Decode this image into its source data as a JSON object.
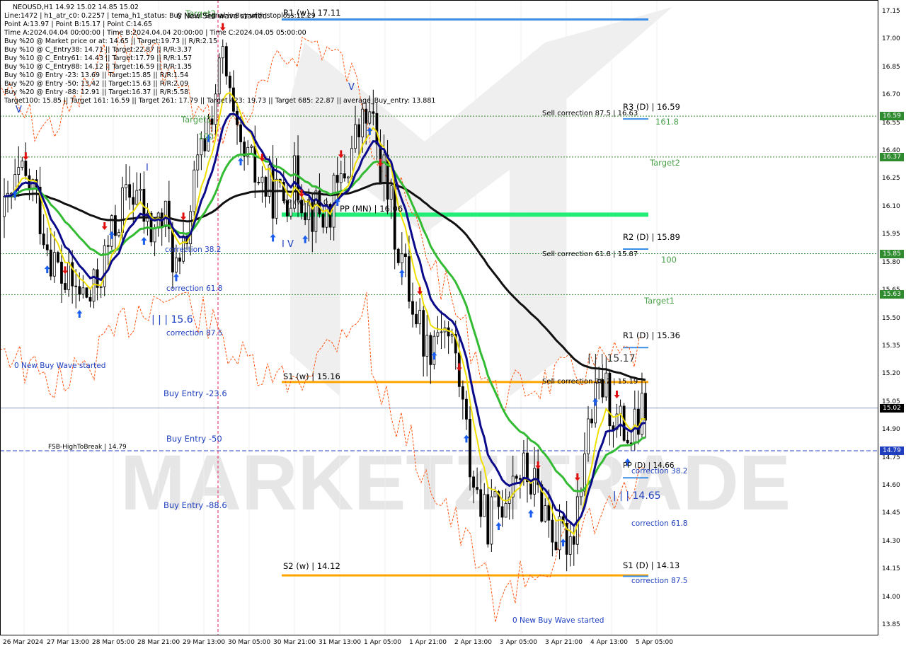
{
  "title": "NEOUSD,H1  14.92 15.02 14.85 15.02",
  "info_lines": [
    "Line:1472 | h1_atr_c0: 0.2257 | tema_h1_status: Buy | Last Signal is:Buy with stoploss:12.29",
    "Point A:13.97 | Point B:15.17 | Point C:14.65",
    "Time A:2024.04.04 00:00:00 | Time B:2024.04.04 20:00:00 | Time C:2024.04.05 05:00:00",
    "Buy %20 @ Market price or at: 14.65 || Target:19.73 || R/R:2.15",
    "Buy %10 @ C_Entry38: 14.71 || Target:22.87 || R/R:3.37",
    "Buy %10 @ C_Entry61: 14.43 || Target:17.79 || R/R:1.57",
    "Buy %10 @ C_Entry88: 14.12 || Target:16.59 || R/R:1.35",
    "Buy %10 @ Entry -23: 13.69 || Target:15.85 || R/R:1.54",
    "Buy %20 @ Entry -50: 13.42 || Target:15.63 || R/R:2.09",
    "Buy %20 @ Entry -88: 12.91 || Target:16.37 || R/R:5.58",
    "Target100: 15.85 || Target 161: 16.59 || Target 261: 17.79 || Target 423: 19.73 || Target 685: 22.87 || average_Buy_entry: 13.881"
  ],
  "watermark": "MARKETZITRADE",
  "y_axis_ticks": [
    "17.15",
    "17.00",
    "16.85",
    "16.70",
    "16.55",
    "16.40",
    "16.25",
    "16.10",
    "15.95",
    "15.80",
    "15.65",
    "15.50",
    "15.35",
    "15.20",
    "15.05",
    "14.90",
    "14.75",
    "14.60",
    "14.45",
    "14.30",
    "14.15",
    "14.00",
    "13.85"
  ],
  "x_axis_ticks": [
    "26 Mar 2024",
    "27 Mar 13:00",
    "28 Mar 05:00",
    "28 Mar 21:00",
    "29 Mar 13:00",
    "30 Mar 05:00",
    "30 Mar 21:00",
    "31 Mar 13:00",
    "1 Apr 05:00",
    "1 Apr 21:00",
    "2 Apr 13:00",
    "3 Apr 05:00",
    "3 Apr 21:00",
    "4 Apr 13:00",
    "5 Apr 05:00"
  ],
  "price_labels": [
    {
      "text": "16.59",
      "color": "#2e8b2e"
    },
    {
      "text": "16.37",
      "color": "#2e8b2e"
    },
    {
      "text": "15.85",
      "color": "#2e8b2e"
    },
    {
      "text": "15.63",
      "color": "#2e8b2e"
    },
    {
      "text": "15.02",
      "color": "#000000"
    },
    {
      "text": "14.79",
      "color": "#1f3fbf"
    }
  ],
  "levels": {
    "r1_w": "R1 (w) | 17.11",
    "s1_w": "S1 (w) | 15.16",
    "s2_w": "S2 (w) | 14.12",
    "pp_mn": "PP (MN) | 16.06",
    "r3_d": "R3 (D) | 16.59",
    "r2_d": "R2 (D) | 15.89",
    "r1_d": "R1 (D) | 15.36",
    "pp_d": "PP (D) | 14.66",
    "s1_d": "S1 (D) | 14.13",
    "fsb": "FSB-HighToBreak | 14.79",
    "sell_875": "Sell correction 87.5 | 16.63",
    "sell_618": "Sell correction 61.8 | 15.87",
    "sell_382": "Sell correction 38.2 | 15.19",
    "target1": "Target1",
    "target2": "Target2",
    "t1618": "161.8",
    "t100_right": "100",
    "t100_left": "100",
    "target1_left": "Target1",
    "target2_left": "Target2",
    "buy_entry_236": "Buy Entry -23.6",
    "buy_entry_50": "Buy Entry -50",
    "buy_entry_886": "Buy Entry -88.6",
    "corr_382_left": "correction 38.2",
    "corr_618_left": "correction 61.8",
    "corr_875_left": "correction 87.5",
    "corr_382_right": "correction 38.2",
    "corr_618_right": "correction 61.8",
    "corr_875_right": "correction 87.5",
    "wave_left": "0 New Buy Wave started",
    "wave_bottom": "0 New Buy Wave started",
    "wave_top": "0 New Sell wave started",
    "lll_156": "| | | 15.6",
    "lll_1517": "| | | 15.17",
    "lll_1465": "| | | 14.65",
    "iv_label": "I V",
    "v_top": "V",
    "v_left": "V",
    "i_left": "I"
  },
  "colors": {
    "ema_blue": "#0a0a8a",
    "ema_yellow": "#f0e000",
    "ema_green": "#33bb33",
    "ma_black": "#111111",
    "weekly_level": "#ffa500",
    "pp_mn": "#22ee77",
    "up_arrow": "#1a5ef0",
    "down_arrow": "#e01010",
    "envelope": "#ff5511"
  },
  "chart_data": {
    "type": "candlestick",
    "symbol": "NEOUSD",
    "timeframe": "H1",
    "ylim": [
      13.8,
      17.2
    ],
    "close_path": [
      16.05,
      16.25,
      16.2,
      15.9,
      15.7,
      15.65,
      15.6,
      15.85,
      16.1,
      16.2,
      15.95,
      16.05,
      15.7,
      16.2,
      16.55,
      16.9,
      16.4,
      16.3,
      16.2,
      16.15,
      16.25,
      16.1,
      16.05,
      16.2,
      16.45,
      16.6,
      16.3,
      15.9,
      15.6,
      15.35,
      15.5,
      15.3,
      14.7,
      14.4,
      14.5,
      14.7,
      14.65,
      14.5,
      14.3,
      14.35,
      14.9,
      15.15,
      14.95,
      14.85,
      15.02
    ]
  }
}
